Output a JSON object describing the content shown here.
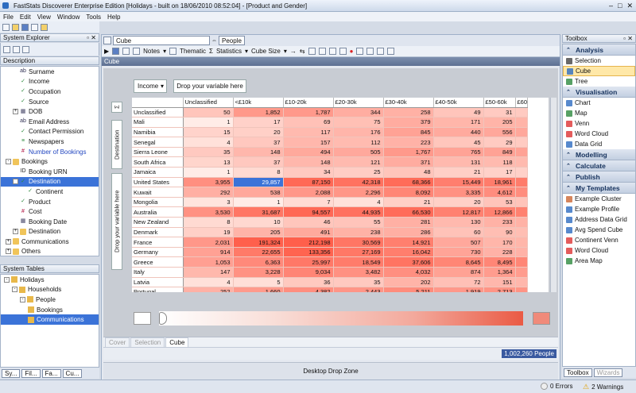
{
  "window": {
    "title": "FastStats Discoverer Enterprise Edition [Holidays - built on 18/06/2010 08:52:04] - [Product and Gender]"
  },
  "menu": [
    "File",
    "Edit",
    "View",
    "Window",
    "Tools",
    "Help"
  ],
  "explorer": {
    "title": "System Explorer",
    "description_header": "Description",
    "items": [
      {
        "label": "Surname",
        "indent": 2,
        "icon": "abc-icon"
      },
      {
        "label": "Income",
        "indent": 2,
        "icon": "selector-icon"
      },
      {
        "label": "Occupation",
        "indent": 2,
        "icon": "selector-icon"
      },
      {
        "label": "Source",
        "indent": 2,
        "icon": "selector-icon"
      },
      {
        "label": "DOB",
        "indent": 1,
        "icon": "date-icon",
        "expander": "+"
      },
      {
        "label": "Email Address",
        "indent": 2,
        "icon": "abc-icon"
      },
      {
        "label": "Contact Permission",
        "indent": 2,
        "icon": "selector-icon"
      },
      {
        "label": "Newspapers",
        "indent": 2,
        "icon": "array-icon"
      },
      {
        "label": "Number of Bookings",
        "indent": 2,
        "icon": "numeric-icon",
        "link": true
      },
      {
        "label": "Bookings",
        "indent": 0,
        "icon": "folder-icon",
        "expander": "-"
      },
      {
        "label": "Booking URN",
        "indent": 2,
        "icon": "id-icon"
      },
      {
        "label": "Destination",
        "indent": 1,
        "icon": "selector-icon",
        "expander": "-",
        "selected": true
      },
      {
        "label": "Continent",
        "indent": 3,
        "icon": "selector-icon"
      },
      {
        "label": "Product",
        "indent": 2,
        "icon": "selector-icon"
      },
      {
        "label": "Cost",
        "indent": 2,
        "icon": "numeric-icon"
      },
      {
        "label": "Booking Date",
        "indent": 2,
        "icon": "date-icon"
      },
      {
        "label": "Destination",
        "indent": 1,
        "icon": "folder-icon",
        "expander": "+"
      },
      {
        "label": "Communications",
        "indent": 0,
        "icon": "folder-icon",
        "expander": "+"
      },
      {
        "label": "Others",
        "indent": 0,
        "icon": "folder-icon",
        "expander": "+"
      }
    ]
  },
  "system_tables": {
    "title": "System Tables",
    "items": [
      {
        "label": "Holidays",
        "indent": 0,
        "expander": "-"
      },
      {
        "label": "Households",
        "indent": 1,
        "expander": "-"
      },
      {
        "label": "People",
        "indent": 2,
        "expander": "-"
      },
      {
        "label": "Bookings",
        "indent": 3
      },
      {
        "label": "Communications",
        "indent": 3,
        "selected": true
      }
    ]
  },
  "bottom_tabs": [
    "Sy...",
    "Fil...",
    "Fa...",
    "Cu..."
  ],
  "doc_tabs": {
    "cube_name": "Cube",
    "people_label": "People"
  },
  "cube_toolbar": {
    "notes": "Notes",
    "thematic": "Thematic",
    "statistics": "Statistics",
    "cube_size": "Cube Size"
  },
  "cube": {
    "header": "Cube",
    "dimension_dropdown": "Income",
    "drop_zone_top": "Drop your variable here",
    "vertical_1": "Destination",
    "vertical_2": "Drop your variable here",
    "columns": [
      "Unclassified",
      "<£10k",
      "£10-20k",
      "£20-30k",
      "£30-40k",
      "£40-50k",
      "£50-60k",
      "£60"
    ],
    "rows": [
      {
        "label": "Unclassified",
        "values": [
          "50",
          "1,852",
          "1,787",
          "344",
          "258",
          "49",
          "31"
        ]
      },
      {
        "label": "Mali",
        "values": [
          "1",
          "17",
          "69",
          "75",
          "379",
          "171",
          "205"
        ]
      },
      {
        "label": "Namibia",
        "values": [
          "15",
          "20",
          "117",
          "176",
          "845",
          "440",
          "556"
        ]
      },
      {
        "label": "Senegal",
        "values": [
          "4",
          "37",
          "157",
          "112",
          "223",
          "45",
          "29"
        ]
      },
      {
        "label": "Sierra Leone",
        "values": [
          "35",
          "148",
          "494",
          "505",
          "1,767",
          "765",
          "849"
        ]
      },
      {
        "label": "South Africa",
        "values": [
          "13",
          "37",
          "148",
          "121",
          "371",
          "131",
          "118"
        ]
      },
      {
        "label": "Jamaica",
        "values": [
          "1",
          "8",
          "34",
          "25",
          "48",
          "21",
          "17"
        ]
      },
      {
        "label": "United States",
        "values": [
          "3,955",
          "29,857",
          "87,150",
          "42,318",
          "68,366",
          "15,449",
          "18,961"
        ]
      },
      {
        "label": "Kuwait",
        "values": [
          "292",
          "538",
          "2,088",
          "2,296",
          "8,092",
          "3,335",
          "4,612"
        ]
      },
      {
        "label": "Mongolia",
        "values": [
          "3",
          "1",
          "7",
          "4",
          "21",
          "20",
          "53"
        ]
      },
      {
        "label": "Australia",
        "values": [
          "3,530",
          "31,687",
          "94,557",
          "44,935",
          "66,530",
          "12,817",
          "12,866"
        ]
      },
      {
        "label": "New Zealand",
        "values": [
          "8",
          "10",
          "46",
          "55",
          "281",
          "130",
          "233"
        ]
      },
      {
        "label": "Denmark",
        "values": [
          "19",
          "205",
          "491",
          "238",
          "286",
          "60",
          "90"
        ]
      },
      {
        "label": "France",
        "values": [
          "2,031",
          "191,324",
          "212,198",
          "30,569",
          "14,921",
          "507",
          "170"
        ]
      },
      {
        "label": "Germany",
        "values": [
          "914",
          "22,655",
          "133,356",
          "27,169",
          "16,042",
          "730",
          "228"
        ]
      },
      {
        "label": "Greece",
        "values": [
          "1,053",
          "6,363",
          "25,997",
          "18,549",
          "37,606",
          "8,645",
          "8,495"
        ]
      },
      {
        "label": "Italy",
        "values": [
          "147",
          "3,228",
          "9,034",
          "3,482",
          "4,032",
          "874",
          "1,364"
        ]
      },
      {
        "label": "Latvia",
        "values": [
          "4",
          "5",
          "36",
          "35",
          "202",
          "72",
          "151"
        ]
      },
      {
        "label": "Portugal",
        "values": [
          "252",
          "1,660",
          "4,382",
          "2,443",
          "5,211",
          "1,919",
          "2,713"
        ]
      }
    ]
  },
  "view_tabs": [
    "Cover",
    "Selection",
    "Cube"
  ],
  "count_badge": "1,002,260 People",
  "desktop_drop_zone": "Desktop Drop Zone",
  "toolbox": {
    "title": "Toolbox",
    "sections": [
      {
        "name": "Analysis",
        "items": [
          {
            "label": "Selection",
            "icon": "selection-icon"
          },
          {
            "label": "Cube",
            "icon": "cube-icon",
            "selected": true
          },
          {
            "label": "Tree",
            "icon": "tree-icon"
          }
        ]
      },
      {
        "name": "Visualisation",
        "items": [
          {
            "label": "Chart",
            "icon": "chart-icon"
          },
          {
            "label": "Map",
            "icon": "map-icon"
          },
          {
            "label": "Venn",
            "icon": "venn-icon"
          },
          {
            "label": "Word Cloud",
            "icon": "word-cloud-icon"
          },
          {
            "label": "Data Grid",
            "icon": "data-grid-icon"
          }
        ]
      },
      {
        "name": "Modelling",
        "items": []
      },
      {
        "name": "Calculate",
        "items": []
      },
      {
        "name": "Publish",
        "items": []
      },
      {
        "name": "My Templates",
        "items": [
          {
            "label": "Example Cluster",
            "icon": "cluster-icon"
          },
          {
            "label": "Example Profile",
            "icon": "profile-icon"
          },
          {
            "label": "Address Data Grid",
            "icon": "data-grid-icon"
          },
          {
            "label": "Avg Spend Cube",
            "icon": "cube-icon"
          },
          {
            "label": "Continent Venn",
            "icon": "venn-icon"
          },
          {
            "label": "Word Cloud",
            "icon": "word-cloud-icon"
          },
          {
            "label": "Area Map",
            "icon": "map-icon"
          }
        ]
      }
    ],
    "bottom_tabs": [
      "Toolbox",
      "Wizards"
    ]
  },
  "status": {
    "errors": "0 Errors",
    "warnings": "2 Warnings"
  }
}
